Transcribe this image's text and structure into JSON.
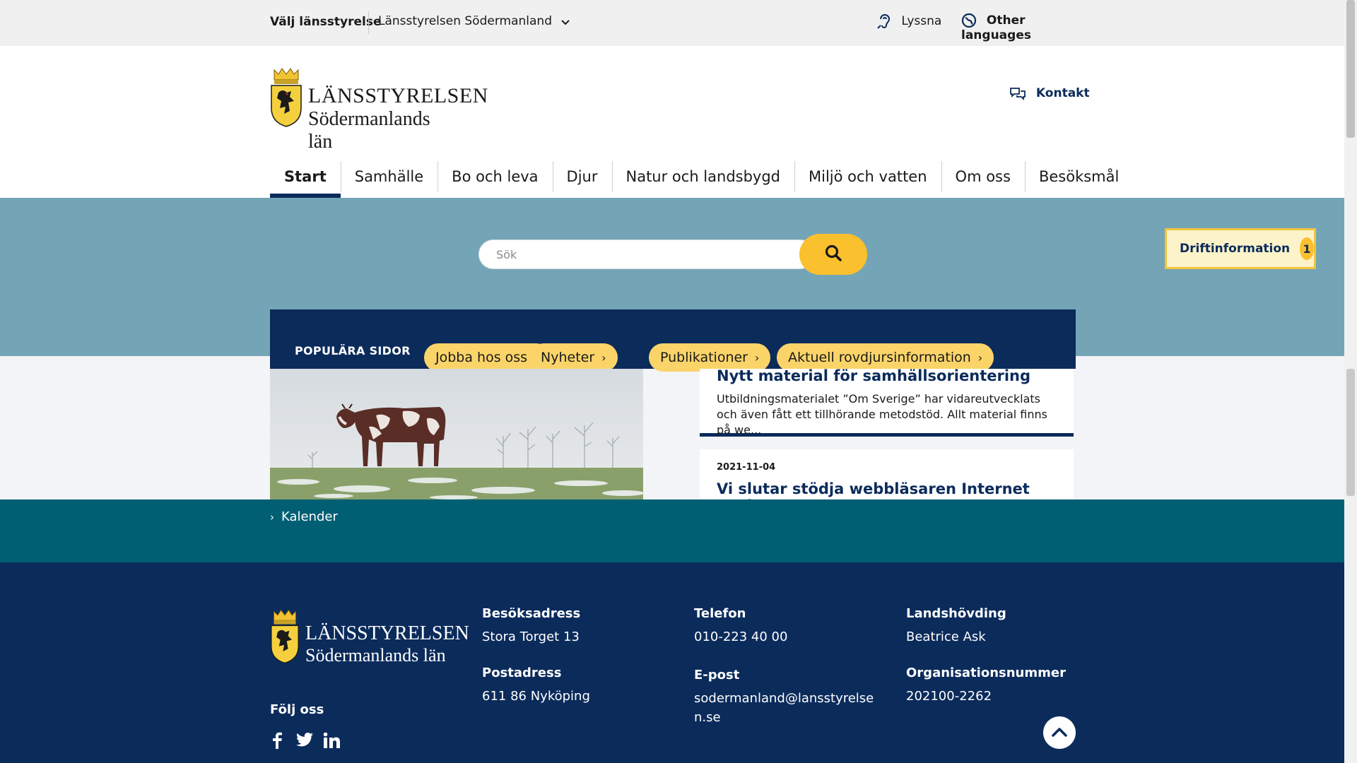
{
  "topbar": {
    "county_label": "Välj länsstyrelse",
    "county_selected": "Länsstyrelsen Södermanland",
    "listen": "Lyssna",
    "languages": "Other languages"
  },
  "header": {
    "logo_line1": "LÄNSSTYRELSEN",
    "logo_line2": "Södermanlands län",
    "contact": "Kontakt"
  },
  "nav": {
    "items": [
      {
        "label": "Start",
        "active": true
      },
      {
        "label": "Samhälle"
      },
      {
        "label": "Bo och leva"
      },
      {
        "label": "Djur"
      },
      {
        "label": "Natur och landsbygd"
      },
      {
        "label": "Miljö och vatten"
      },
      {
        "label": "Om oss"
      },
      {
        "label": "Besöksmål"
      }
    ]
  },
  "search": {
    "placeholder": "Sök"
  },
  "ops": {
    "label": "Driftinformation",
    "count": "1"
  },
  "popular": {
    "label": "POPULÄRA SIDOR",
    "chips": [
      {
        "label": "Jobba hos oss"
      },
      {
        "label": "Nyheter"
      },
      {
        "label": "Publikationer"
      },
      {
        "label": "Aktuell rovdjursinformation"
      }
    ]
  },
  "news": [
    {
      "title": "Nytt material för samhällsorientering",
      "text": "Utbildningsmaterialet ”Om Sverige” har vidareutvecklats och även fått ett tillhörande metodstöd. Allt material finns på we..."
    },
    {
      "date": "2021-11-04",
      "title": "Vi slutar stödja webbläsaren Internet Explorer"
    }
  ],
  "calendar": {
    "label": "Kalender"
  },
  "footer": {
    "logo_line1": "LÄNSSTYRELSEN",
    "logo_line2": "Södermanlands län",
    "follow": "Följ oss",
    "visit_head": "Besöksadress",
    "visit_val": "Stora Torget 13",
    "post_head": "Postadress",
    "post_val": "611 86 Nyköping",
    "phone_head": "Telefon",
    "phone_val": "010-223 40 00",
    "email_head": "E-post",
    "email_val_1": "sodermanland@lansstyrelse",
    "email_val_2": "n.se",
    "gov_head": "Landshövding",
    "gov_val": "Beatrice Ask",
    "org_head": "Organisationsnummer",
    "org_val": "202100-2262"
  },
  "icons": {
    "chevron": "chevron-down-icon",
    "listen": "hearing-icon",
    "languages": "globe-icon",
    "contact": "chat-bubbles-icon",
    "search": "search-icon",
    "facebook": "facebook-icon",
    "twitter": "twitter-icon",
    "linkedin": "linkedin-icon",
    "totop": "chevron-up-icon"
  },
  "colors": {
    "navy": "#0b2b5b",
    "teal": "#005f73",
    "search_band": "#74a5b6",
    "accent_yellow": "#fbc02d"
  }
}
